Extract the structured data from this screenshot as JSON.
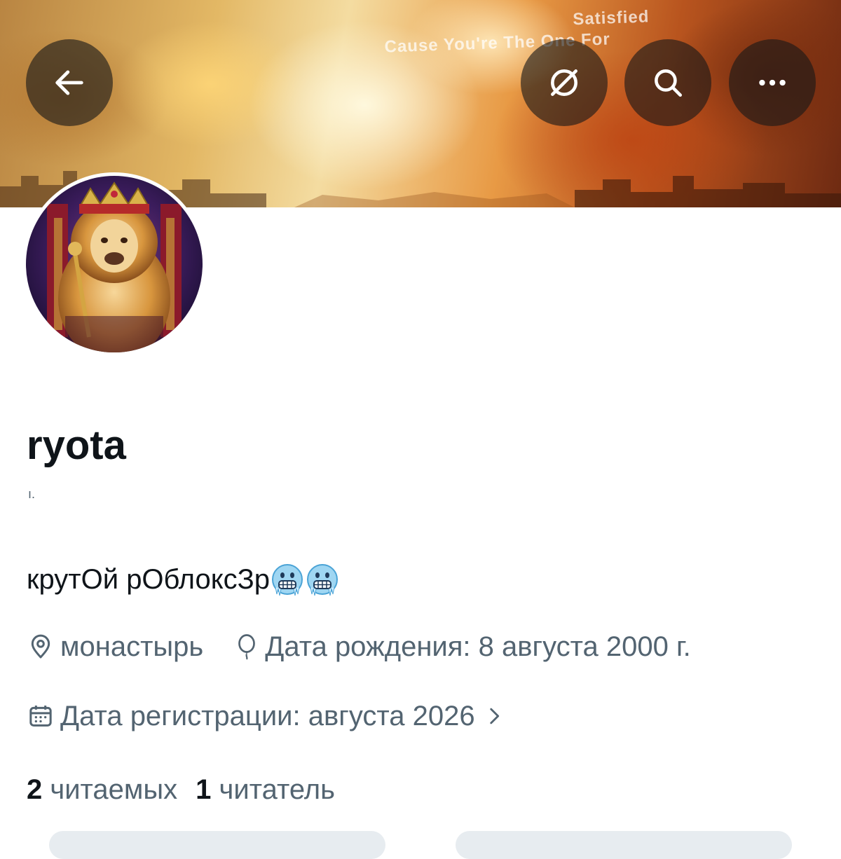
{
  "header": {
    "banner_text": [
      "Satisfied",
      "Cause You're The One For"
    ],
    "back_button": {
      "icon": "arrow-left-icon"
    },
    "grok_button": {
      "icon": "slash-circle-icon"
    },
    "search_button": {
      "icon": "search-icon"
    },
    "more_button": {
      "icon": "more-horizontal-icon"
    }
  },
  "profile": {
    "display_name": "ryota",
    "handle": "ı.",
    "bio": "крутОй рОблоксЗр",
    "bio_emoji": [
      "freezing-face",
      "freezing-face"
    ],
    "location": "монастырь",
    "birthday": "Дата рождения: 8 августа 2000 г.",
    "joined": "Дата регистрации: августа 2026",
    "following_count": "2",
    "following_label": "читаемых",
    "followers_count": "1",
    "followers_label": "читатель"
  },
  "colors": {
    "text_primary": "#0f1419",
    "text_secondary": "#536471",
    "button_overlay": "#181818"
  }
}
